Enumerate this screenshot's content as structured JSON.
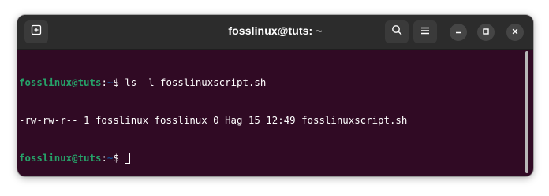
{
  "window": {
    "title": "fosslinux@tuts: ~"
  },
  "headerbar": {
    "new_tab_icon": "new-tab-icon",
    "search_icon": "search-icon",
    "menu_icon": "hamburger-menu-icon",
    "minimize_icon": "minimize-icon",
    "maximize_icon": "maximize-icon",
    "close_icon": "close-icon"
  },
  "terminal": {
    "lines": [
      {
        "user_host": "fosslinux@tuts",
        "sep": ":",
        "path": "~",
        "symbol": "$ ",
        "command": "ls -l fosslinuxscript.sh"
      },
      {
        "output": "-rw-rw-r-- 1 fosslinux fosslinux 0 Hag 15 12:49 fosslinuxscript.sh"
      },
      {
        "user_host": "fosslinux@tuts",
        "sep": ":",
        "path": "~",
        "symbol": "$ ",
        "command": ""
      }
    ]
  },
  "colors": {
    "terminal_bg": "#300a24",
    "titlebar_bg": "#2c2c2c",
    "prompt_user": "#26a269",
    "prompt_path": "#12488b",
    "text": "#ffffff"
  }
}
